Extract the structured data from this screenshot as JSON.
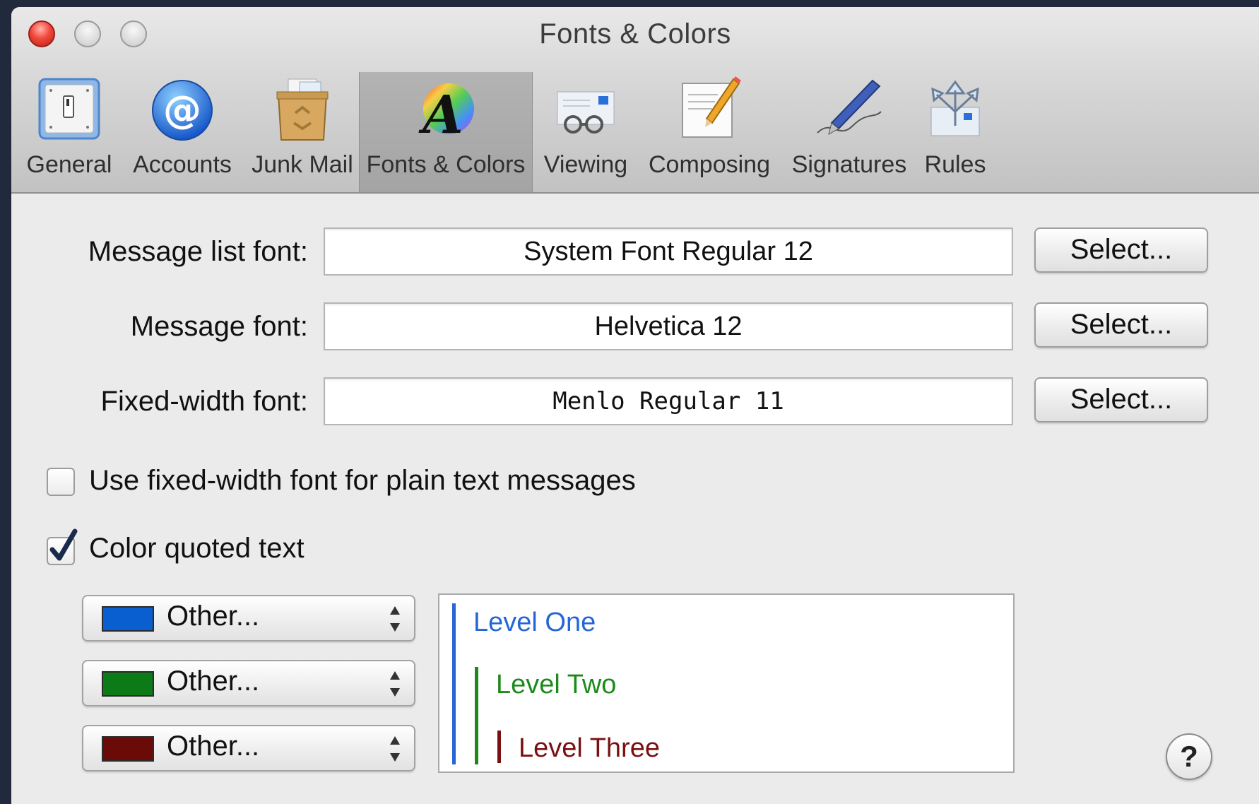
{
  "window": {
    "title": "Fonts & Colors"
  },
  "toolbar": {
    "items": [
      {
        "label": "General",
        "icon": "general-switch-icon"
      },
      {
        "label": "Accounts",
        "icon": "at-sign-icon"
      },
      {
        "label": "Junk Mail",
        "icon": "junk-mail-icon"
      },
      {
        "label": "Fonts & Colors",
        "icon": "fonts-colors-icon",
        "selected": true
      },
      {
        "label": "Viewing",
        "icon": "viewing-glasses-icon"
      },
      {
        "label": "Composing",
        "icon": "composing-pencil-icon"
      },
      {
        "label": "Signatures",
        "icon": "signature-pen-icon"
      },
      {
        "label": "Rules",
        "icon": "rules-arrows-icon"
      }
    ]
  },
  "fonts": {
    "message_list": {
      "label": "Message list font:",
      "value": "System Font Regular 12",
      "button": "Select..."
    },
    "message": {
      "label": "Message font:",
      "value": "Helvetica 12",
      "button": "Select..."
    },
    "fixed_width": {
      "label": "Fixed-width font:",
      "value": "Menlo Regular 11",
      "button": "Select..."
    }
  },
  "options": {
    "use_fixed_width": {
      "label": "Use fixed-width font for plain text messages",
      "checked": false
    },
    "color_quoted": {
      "label": "Color quoted text",
      "checked": true
    }
  },
  "quote_colors": [
    {
      "label": "Other...",
      "color": "#0a5fd0"
    },
    {
      "label": "Other...",
      "color": "#0b7a17"
    },
    {
      "label": "Other...",
      "color": "#6a0b07"
    }
  ],
  "preview": {
    "level_one": "Level One",
    "level_two": "Level Two",
    "level_three": "Level Three"
  },
  "help": {
    "label": "?"
  },
  "colors": {
    "level_one": "#2566d6",
    "level_two": "#1b8a1b",
    "level_three": "#7a1010"
  }
}
